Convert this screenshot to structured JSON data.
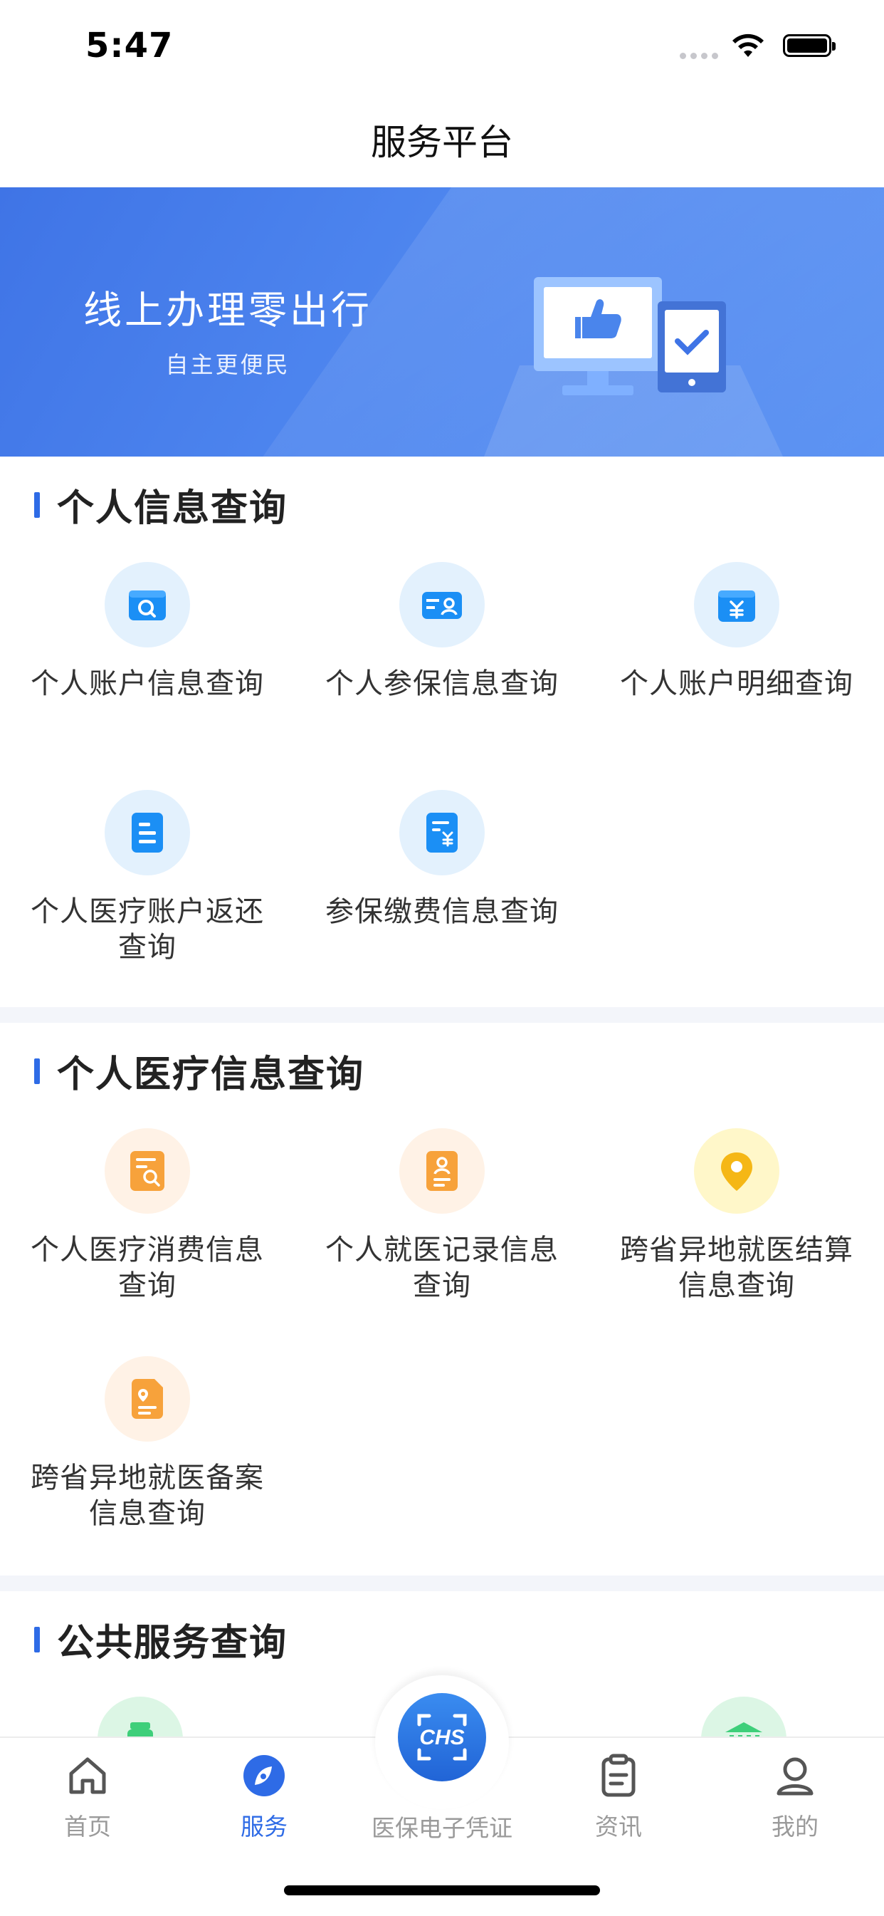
{
  "status_bar": {
    "time": "5:47"
  },
  "nav": {
    "title": "服务平台"
  },
  "banner": {
    "headline": "线上办理零出行",
    "subtitle": "自主更便民"
  },
  "sections": [
    {
      "title": "个人信息查询",
      "items": [
        {
          "label": "个人账户信息查询",
          "icon": "account-search-icon"
        },
        {
          "label": "个人参保信息查询",
          "icon": "insurance-card-icon"
        },
        {
          "label": "个人账户明细查询",
          "icon": "yuan-wallet-icon"
        },
        {
          "label": "个人医疗账户返还查询",
          "icon": "document-list-icon"
        },
        {
          "label": "参保缴费信息查询",
          "icon": "payment-doc-icon"
        }
      ]
    },
    {
      "title": "个人医疗信息查询",
      "items": [
        {
          "label": "个人医疗消费信息查询",
          "icon": "consumption-search-icon"
        },
        {
          "label": "个人就医记录信息查询",
          "icon": "medical-record-icon"
        },
        {
          "label": "跨省异地就医结算信息查询",
          "icon": "location-pin-icon"
        },
        {
          "label": "跨省异地就医备案信息查询",
          "icon": "filing-location-icon"
        }
      ]
    },
    {
      "title": "公共服务查询",
      "items": []
    }
  ],
  "tabbar": {
    "home": "首页",
    "services": "服务",
    "center": "医保电子凭证",
    "news": "资讯",
    "mine": "我的",
    "center_logo": "CHS"
  },
  "colors": {
    "accent": "#2e6be6",
    "banner": "#4e86ef",
    "orange": "#f7a23b"
  }
}
